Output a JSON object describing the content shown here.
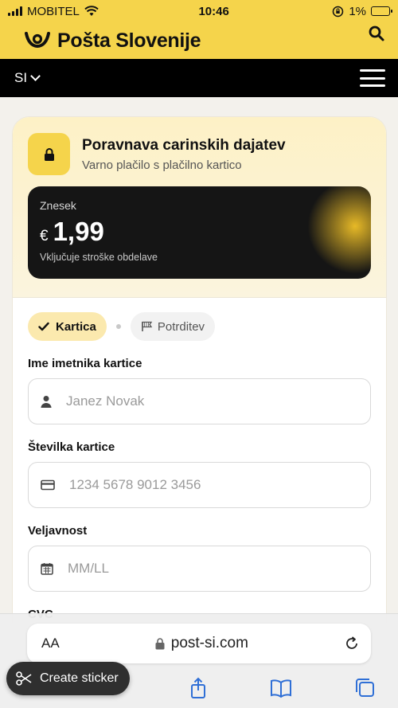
{
  "status_bar": {
    "carrier": "MOBITEL",
    "time": "10:46",
    "battery": "1%"
  },
  "brand": {
    "name": "Pošta Slovenije",
    "color": "#f5d44b"
  },
  "nav": {
    "language": "SI"
  },
  "payment": {
    "title": "Poravnava carinskih dajatev",
    "subtitle": "Varno plačilo s plačilno kartico",
    "amount_label": "Znesek",
    "currency": "€",
    "amount": "1,99",
    "amount_note": "Vključuje stroške obdelave"
  },
  "steps": [
    {
      "label": "Kartica",
      "active": true
    },
    {
      "label": "Potrditev",
      "active": false
    }
  ],
  "form": {
    "name_label": "Ime imetnika kartice",
    "name_placeholder": "Janez Novak",
    "card_label": "Številka kartice",
    "card_placeholder": "1234 5678 9012 3456",
    "expiry_label": "Veljavnost",
    "expiry_placeholder": "MM/LL",
    "cvc_label": "CVC"
  },
  "browser": {
    "text_size": "AA",
    "url": "post-si.com",
    "sticker_label": "Create sticker"
  }
}
